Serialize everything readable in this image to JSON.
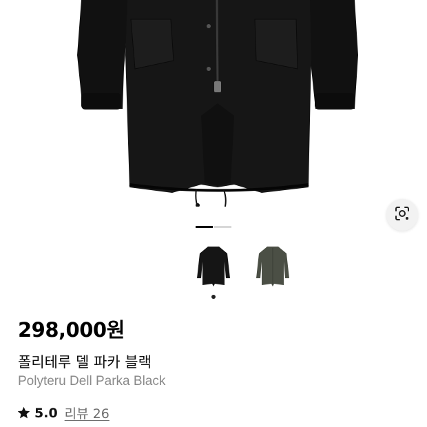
{
  "product": {
    "price": "298,000원",
    "name_ko": "폴리테루 델 파카 블랙",
    "name_en": "Polyteru Dell Parka Black",
    "rating": "5.0",
    "reviews_label": "리뷰 26"
  },
  "gallery": {
    "pager_count": 2,
    "active_index": 0,
    "thumbnails": [
      {
        "color": "#151515",
        "selected": true
      },
      {
        "color": "#4b4f45",
        "selected": false
      }
    ]
  },
  "icons": {
    "lens_button": "camera-lens-icon",
    "rating": "star-icon"
  }
}
